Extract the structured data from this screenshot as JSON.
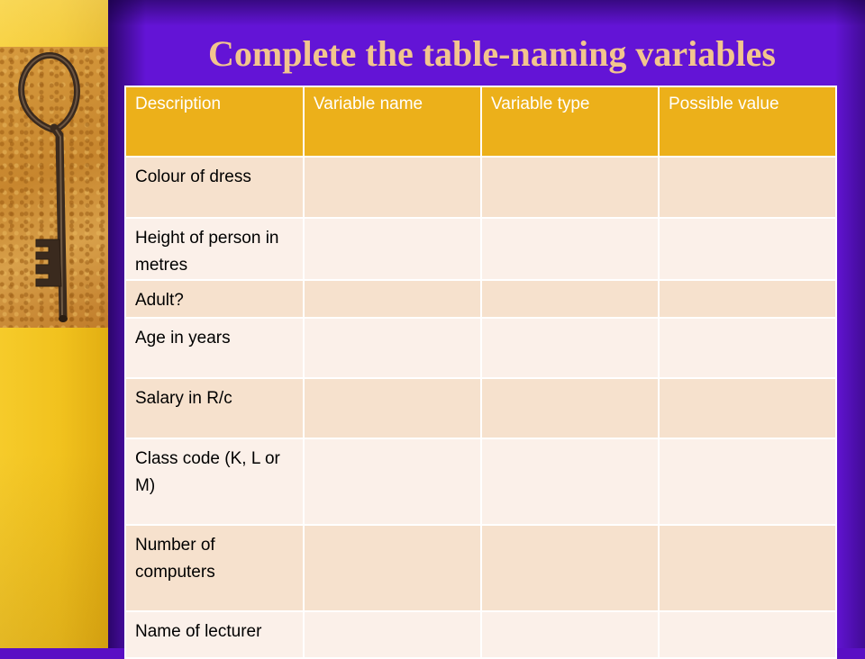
{
  "slide": {
    "title": "Complete the table-naming variables"
  },
  "colors": {
    "background": "#6314d6",
    "accent_strip": "#f1c21e",
    "title_text": "#f2c58e",
    "header_fill": "#ecb01a",
    "row_fill_odd": "#f6e1cd",
    "row_fill_even": "#fbf0e9"
  },
  "images": {
    "left_picture": "old-iron-key-on-sand"
  },
  "table": {
    "headers": [
      "Description",
      "Variable name",
      "Variable type",
      "Possible value"
    ],
    "rows": [
      [
        "Colour of dress",
        "",
        "",
        ""
      ],
      [
        "Height of person in metres",
        "",
        "",
        ""
      ],
      [
        "Adult?",
        "",
        "",
        ""
      ],
      [
        "Age in years",
        "",
        "",
        ""
      ],
      [
        "Salary in R/c",
        "",
        "",
        ""
      ],
      [
        "Class code (K, L or M)",
        "",
        "",
        ""
      ],
      [
        "Number of computers",
        "",
        "",
        ""
      ],
      [
        "Name of lecturer",
        "",
        "",
        ""
      ]
    ]
  }
}
